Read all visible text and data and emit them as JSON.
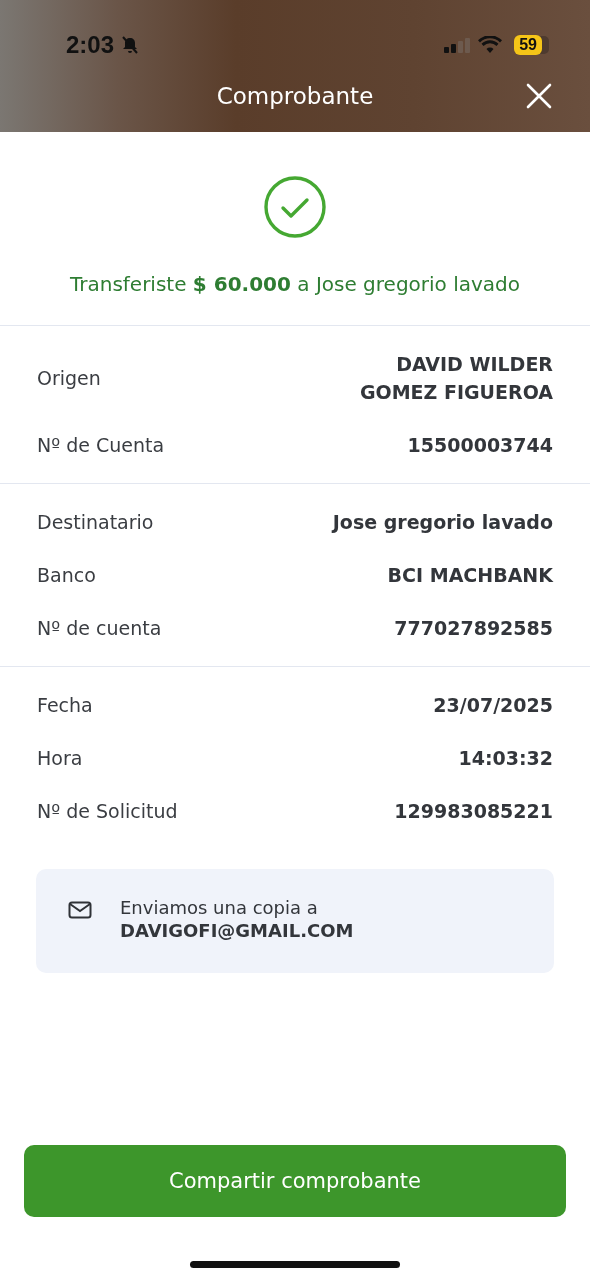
{
  "status_bar": {
    "time": "2:03",
    "silent": true,
    "battery": "59"
  },
  "header": {
    "title": "Comprobante"
  },
  "result": {
    "success": true,
    "message": "Transferiste **$ 60.000** a Jose gregorio lavado"
  },
  "sections": [
    {
      "rows": [
        {
          "label": "Origen",
          "value": "DAVID WILDER GOMEZ FIGUEROA"
        },
        {
          "label": "Nº de Cuenta",
          "value": "15500003744"
        }
      ]
    },
    {
      "rows": [
        {
          "label": "Destinatario",
          "value": "Jose gregorio lavado"
        },
        {
          "label": "Banco",
          "value": "BCI MACHBANK"
        },
        {
          "label": "Nº de cuenta",
          "value": "777027892585"
        }
      ]
    },
    {
      "rows": [
        {
          "label": "Fecha",
          "value": "23/07/2025"
        },
        {
          "label": "Hora",
          "value": "14:03:32"
        },
        {
          "label": "Nº de Solicitud",
          "value": "129983085221"
        }
      ]
    }
  ],
  "email_notice": {
    "text": "Enviamos una copia a",
    "email": "DAVIGOFI@GMAIL.COM"
  },
  "share_button": "Compartir comprobante"
}
